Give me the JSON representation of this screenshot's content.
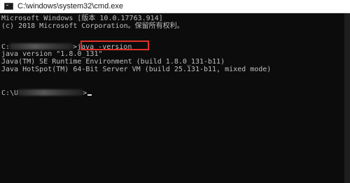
{
  "window": {
    "title": "C:\\windows\\system32\\cmd.exe"
  },
  "console": {
    "line1": "Microsoft Windows [版本 10.0.17763.914]",
    "line2": "(c) 2018 Microsoft Corporation。保留所有权利。",
    "prompt1_drive": "C:",
    "command": "java -version",
    "line4": "java version \"1.8.0_131\"",
    "line5": "Java(TM) SE Runtime Environment (build 1.8.0_131-b11)",
    "line6": "Java HotSpot(TM) 64-Bit Server VM (build 25.131-b11, mixed mode)",
    "prompt2_drive": "C:\\U",
    "prompt_symbol": ">"
  },
  "colors": {
    "console_bg": "#0c0c0c",
    "console_text": "#c0c0c0",
    "highlight_border": "#e0302a"
  }
}
